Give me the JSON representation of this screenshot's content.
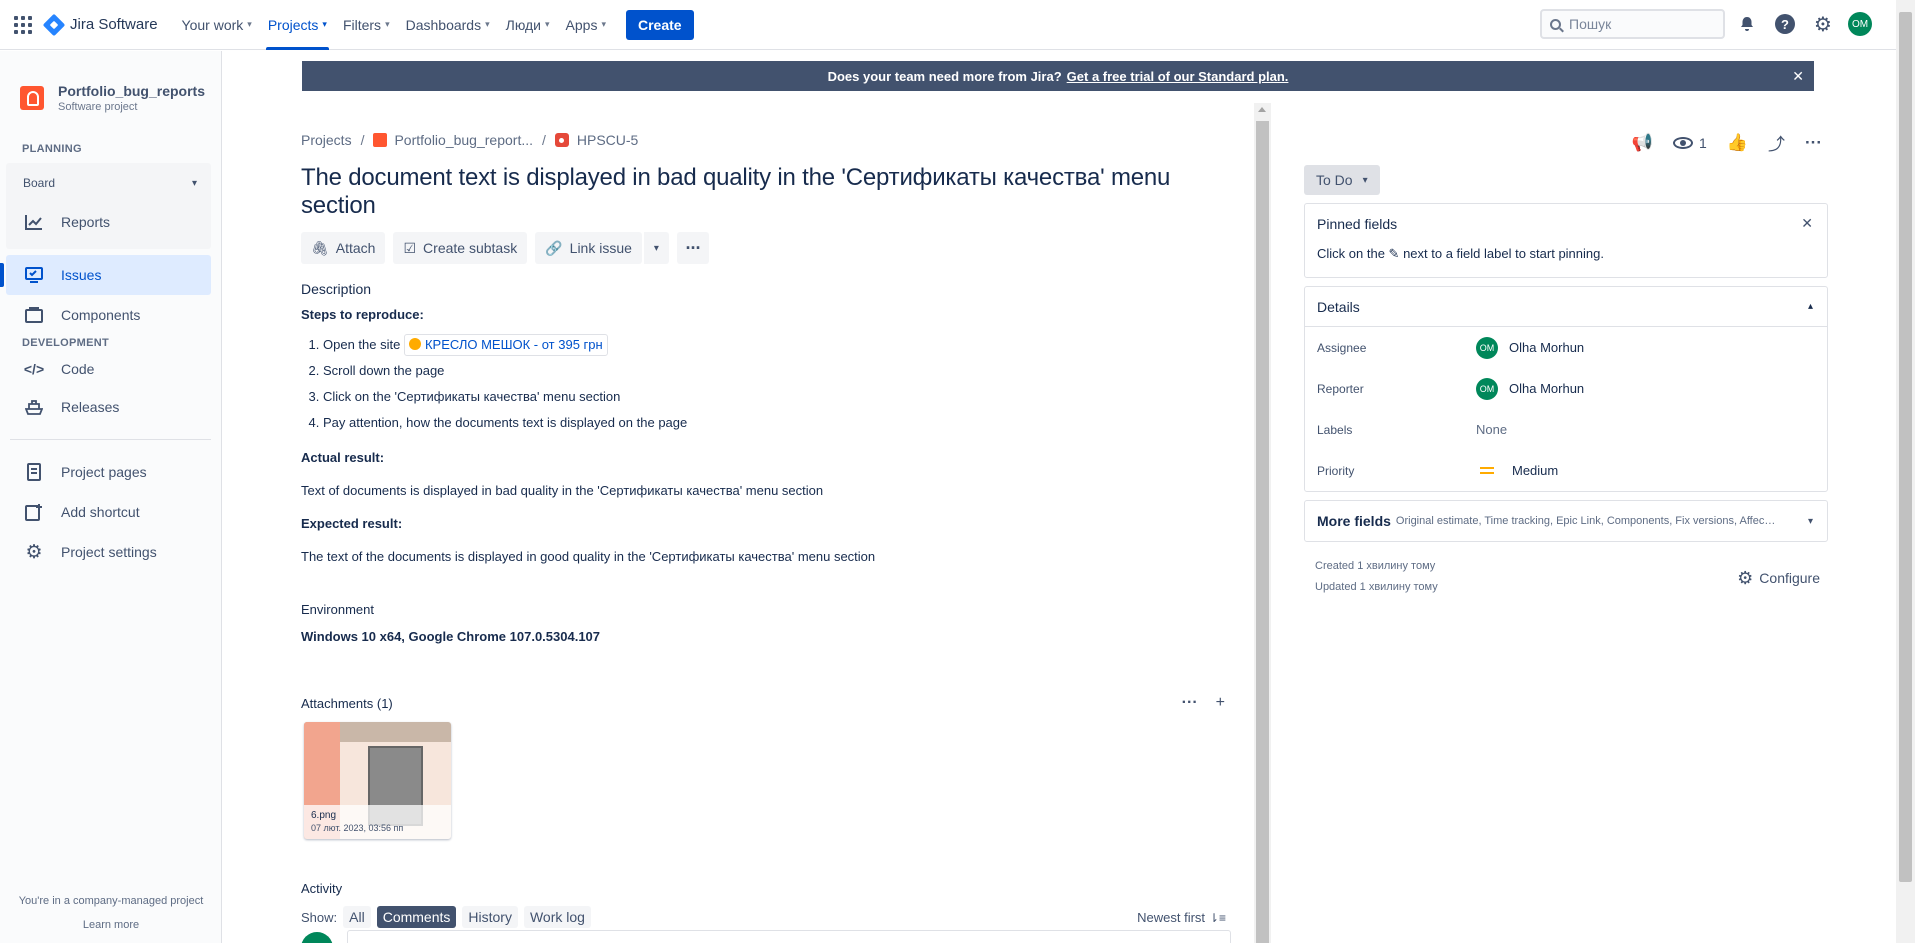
{
  "nav": {
    "logo": "Jira Software",
    "items": [
      {
        "label": "Your work"
      },
      {
        "label": "Projects"
      },
      {
        "label": "Filters"
      },
      {
        "label": "Dashboards"
      },
      {
        "label": "Люди"
      },
      {
        "label": "Apps"
      }
    ],
    "active_item": "Projects",
    "create_label": "Create",
    "search_placeholder": "Пошук",
    "avatar_initials": "OM"
  },
  "sidebar": {
    "project_name": "Portfolio_bug_reports",
    "project_type": "Software project",
    "planning_title": "PLANNING",
    "board_label": "Board",
    "reports_label": "Reports",
    "issues_label": "Issues",
    "components_label": "Components",
    "development_title": "DEVELOPMENT",
    "code_label": "Code",
    "releases_label": "Releases",
    "project_pages_label": "Project pages",
    "add_shortcut_label": "Add shortcut",
    "project_settings_label": "Project settings",
    "footer_text": "You're in a company-managed project",
    "learn_more": "Learn more"
  },
  "banner": {
    "text": "Does your team need more from Jira?",
    "link": "Get a free trial of our Standard plan."
  },
  "breadcrumb": {
    "projects": "Projects",
    "project": "Portfolio_bug_report...",
    "issue_key": "HPSCU-5"
  },
  "issue": {
    "title": "The document text is displayed in bad quality in the 'Сертификаты качества' menu section",
    "actions": {
      "attach": "Attach",
      "create_subtask": "Create subtask",
      "link_issue": "Link issue"
    },
    "description_label": "Description",
    "steps_heading": "Steps to reproduce:",
    "step1_prefix": "Open the site",
    "step1_link": "КРЕСЛО МЕШОК - от 395 грн",
    "step2": "Scroll down the page",
    "step3": "Click on the 'Сертификаты качества' menu section",
    "step4": "Pay attention, how the documents text is displayed on the page",
    "actual_heading": "Actual result:",
    "actual_text": "Text of documents is displayed in bad quality in the 'Сертификаты качества' menu section",
    "expected_heading": "Expected result:",
    "expected_text": "The text of the documents is displayed in good quality in the 'Сертификаты качества' menu section",
    "environment_label": "Environment",
    "environment_value": "Windows 10 x64, Google Chrome 107.0.5304.107",
    "attachments_label": "Attachments (1)",
    "attachment_name": "6.png",
    "attachment_date": "07 лют. 2023, 03:56 пп"
  },
  "activity": {
    "heading": "Activity",
    "show_label": "Show:",
    "filters": [
      "All",
      "Comments",
      "History",
      "Work log"
    ],
    "selected_filter": "Comments",
    "sort_label": "Newest first"
  },
  "right": {
    "watch_count": "1",
    "status": "To Do",
    "pinned_title": "Pinned fields",
    "pinned_text_a": "Click on the",
    "pinned_text_b": "next to a field label to start pinning.",
    "details_title": "Details",
    "assignee_label": "Assignee",
    "assignee_value": "Olha Morhun",
    "reporter_label": "Reporter",
    "reporter_value": "Olha Morhun",
    "user_initials": "OM",
    "labels_label": "Labels",
    "labels_value": "None",
    "priority_label": "Priority",
    "priority_value": "Medium",
    "more_fields_label": "More fields",
    "more_fields_sub": "Original estimate, Time tracking, Epic Link, Components, Fix versions, Affects v...",
    "created": "Created 1 хвилину тому",
    "updated": "Updated 1 хвилину тому",
    "configure": "Configure"
  },
  "colors": {
    "brand": "#0052cc",
    "banner_bg": "#42526e",
    "avatar_green": "#00875a",
    "priority_medium": "#ffab00"
  }
}
